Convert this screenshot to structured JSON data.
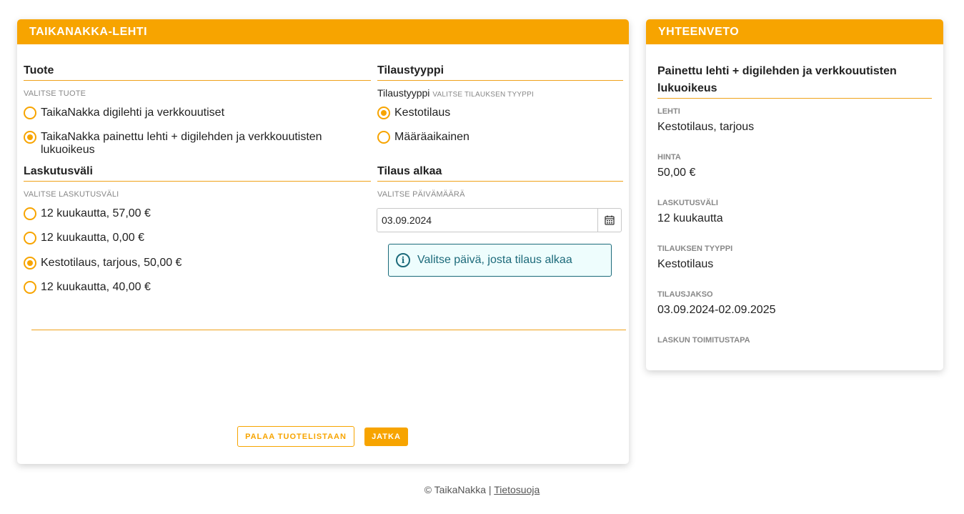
{
  "main": {
    "header": "TAIKANAKKA-LEHTI",
    "product": {
      "title": "Tuote",
      "hint": "VALITSE TUOTE",
      "options": [
        {
          "label": "TaikaNakka digilehti ja verkkouutiset",
          "checked": false
        },
        {
          "label": "TaikaNakka painettu lehti + digilehden ja verkkouutisten lukuoikeus",
          "checked": true
        }
      ]
    },
    "order_type": {
      "title": "Tilaustyyppi",
      "label": "Tilaustyyppi",
      "hint": "VALITSE TILAUKSEN TYYPPI",
      "options": [
        {
          "label": "Kestotilaus",
          "checked": true
        },
        {
          "label": "Määräaikainen",
          "checked": false
        }
      ]
    },
    "billing": {
      "title": "Laskutusväli",
      "hint": "VALITSE LASKUTUSVÄLI",
      "options": [
        {
          "label": "12 kuukautta, 57,00 €",
          "checked": false
        },
        {
          "label": "12 kuukautta, 0,00 €",
          "checked": false
        },
        {
          "label": "Kestotilaus, tarjous, 50,00 €",
          "checked": true
        },
        {
          "label": "12 kuukautta, 40,00 €",
          "checked": false
        }
      ]
    },
    "start": {
      "title": "Tilaus alkaa",
      "hint": "VALITSE PÄIVÄMÄÄRÄ",
      "date_value": "03.09.2024",
      "info": "Valitse päivä, josta tilaus alkaa"
    },
    "buttons": {
      "back": "PALAA TUOTELISTAAN",
      "next": "JATKA"
    }
  },
  "summary": {
    "header": "YHTEENVETO",
    "product": "Painettu lehti + digilehden ja verkkouutisten lukuoikeus",
    "fields": [
      {
        "label": "LEHTI",
        "value": "Kestotilaus, tarjous"
      },
      {
        "label": "HINTA",
        "value": "50,00 €"
      },
      {
        "label": "LASKUTUSVÄLI",
        "value": "12 kuukautta"
      },
      {
        "label": "TILAUKSEN TYYPPI",
        "value": "Kestotilaus"
      },
      {
        "label": "TILAUSJAKSO",
        "value": "03.09.2024-02.09.2025"
      },
      {
        "label": "LASKUN TOIMITUSTAPA",
        "value": ""
      }
    ]
  },
  "footer": {
    "copyright": "© TaikaNakka |",
    "privacy_link": "Tietosuoja"
  },
  "colors": {
    "accent": "#f7a400",
    "info": "#1c6a7a",
    "info_bg": "#eefdfd"
  }
}
